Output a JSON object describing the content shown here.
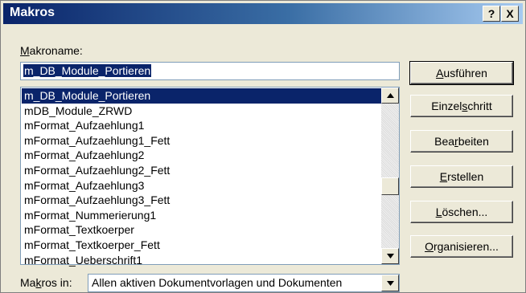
{
  "window": {
    "title": "Makros",
    "help_label": "?",
    "close_label": "X"
  },
  "macro_name": {
    "label_accel": "M",
    "label_rest": "akroname:",
    "value": "m_DB_Module_Portieren"
  },
  "macro_list": {
    "items": [
      "m_DB_Module_Portieren",
      "mDB_Module_ZRWD",
      "mFormat_Aufzaehlung1",
      "mFormat_Aufzaehlung1_Fett",
      "mFormat_Aufzaehlung2",
      "mFormat_Aufzaehlung2_Fett",
      "mFormat_Aufzaehlung3",
      "mFormat_Aufzaehlung3_Fett",
      "mFormat_Nummerierung1",
      "mFormat_Textkoerper",
      "mFormat_Textkoerper_Fett",
      "mFormat_Ueberschrift1"
    ],
    "selected_index": 0
  },
  "buttons": {
    "run": {
      "pre": "",
      "accel": "A",
      "post": "usführen"
    },
    "step": {
      "pre": "Einzel",
      "accel": "s",
      "post": "chritt"
    },
    "edit": {
      "pre": "Bea",
      "accel": "r",
      "post": "beiten"
    },
    "create": {
      "pre": "",
      "accel": "E",
      "post": "rstellen"
    },
    "delete": {
      "pre": "",
      "accel": "L",
      "post": "öschen..."
    },
    "organize": {
      "pre": "",
      "accel": "O",
      "post": "rganisieren..."
    }
  },
  "macros_in": {
    "label_pre": "Ma",
    "label_accel": "k",
    "label_post": "ros in:",
    "value": "Allen aktiven Dokumentvorlagen und Dokumenten"
  },
  "colors": {
    "selection": "#0a246a",
    "dialog_bg": "#ece9d8"
  }
}
